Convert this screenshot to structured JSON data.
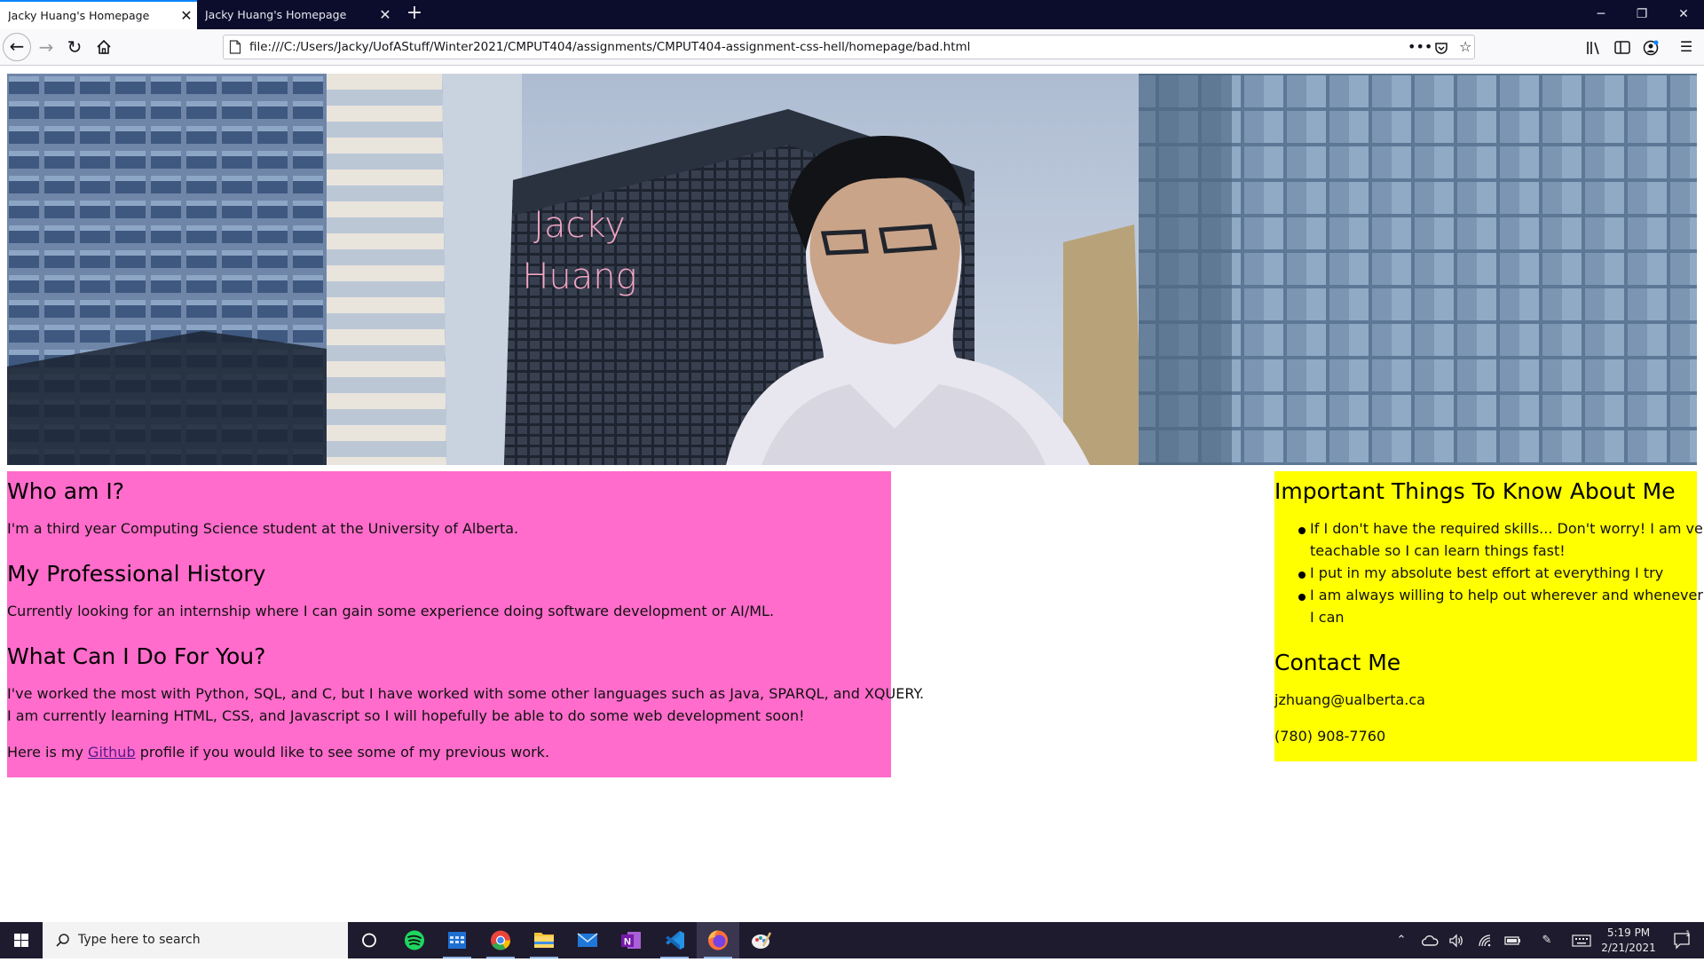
{
  "browser": {
    "tabs": [
      {
        "title": "Jacky Huang's Homepage",
        "active": true
      },
      {
        "title": "Jacky Huang's Homepage",
        "active": false
      }
    ],
    "new_tab_label": "+",
    "url": "file:///C:/Users/Jacky/UofAStuff/Winter2021/CMPUT404/assignments/CMPUT404-assignment-css-hell/homepage/bad.html",
    "accent_color": "#0a84ff"
  },
  "page": {
    "hero": {
      "name_line1": "Jacky",
      "name_line2": "Huang",
      "name_color": "#f2a5c2"
    },
    "left": {
      "background": "#ff6ccb",
      "who_heading": "Who am I?",
      "who_text": "I'm a third year Computing Science student at the University of Alberta.",
      "history_heading": "My Professional History",
      "history_text": "Currently looking for an internship where I can gain some experience doing software development or AI/ML.",
      "can_do_heading": "What Can I Do For You?",
      "can_do_line1": "I've worked the most with Python, SQL, and C, but I have worked with some other languages such as Java, SPARQL, and XQUERY.",
      "can_do_line2": "I am currently learning HTML, CSS, and Javascript so I will hopefully be able to do some web development soon!",
      "github_prefix": "Here is my ",
      "github_link": "Github",
      "github_suffix": " profile if you would like to see some of my previous work."
    },
    "right": {
      "background": "#ffff00",
      "important_heading": "Important Things To Know About Me",
      "items": [
        {
          "line1": "If I don't have the required skills... Don't worry! I am very",
          "line2": "teachable so I can learn things fast!"
        },
        {
          "line1": "I put in my absolute best effort at everything I try",
          "line2": ""
        },
        {
          "line1": "I am always willing to help out wherever and whenever",
          "line2": "I can"
        }
      ],
      "contact_heading": "Contact Me",
      "email": "jzhuang@ualberta.ca",
      "phone": "(780) 908-7760"
    }
  },
  "taskbar": {
    "search_placeholder": "Type here to search",
    "apps": [
      "task-view",
      "spotify",
      "calendar",
      "chrome",
      "file-explorer",
      "mail",
      "onenote",
      "vscode",
      "firefox",
      "paint"
    ],
    "time": "5:19 PM",
    "date": "2/21/2021",
    "notification_count": "1"
  }
}
